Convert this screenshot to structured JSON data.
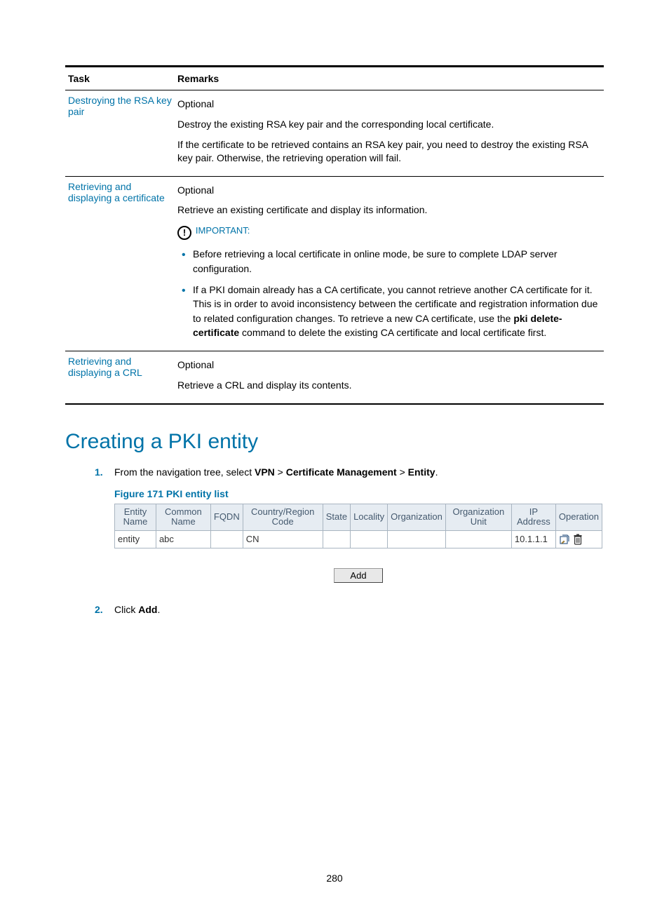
{
  "table": {
    "headers": {
      "task": "Task",
      "remarks": "Remarks"
    },
    "row1": {
      "task": "Destroying the RSA key pair",
      "p1": "Optional",
      "p2": "Destroy the existing RSA key pair and the corresponding local certificate.",
      "p3": "If the certificate to be retrieved contains an RSA key pair, you need to destroy the existing RSA key pair. Otherwise, the retrieving operation will fail."
    },
    "row2": {
      "task": "Retrieving and displaying a certificate",
      "p1": "Optional",
      "p2": "Retrieve an existing certificate and display its information.",
      "important": "IMPORTANT:",
      "b1": "Before retrieving a local certificate in online mode, be sure to complete LDAP server configuration.",
      "b2a": "If a PKI domain already has a CA certificate, you cannot retrieve another CA certificate for it. This is in order to avoid inconsistency between the certificate and registration information due to related configuration changes. To retrieve a new CA certificate, use the ",
      "b2cmd": "pki delete-certificate",
      "b2b": " command to delete the existing CA certificate and local certificate first."
    },
    "row3": {
      "task": "Retrieving and displaying a CRL",
      "p1": "Optional",
      "p2": "Retrieve a CRL and display its contents."
    }
  },
  "heading": "Creating a PKI entity",
  "step1": {
    "pre": "From the navigation tree, select ",
    "b1": "VPN",
    "s1": " > ",
    "b2": "Certificate Management",
    "s2": " > ",
    "b3": "Entity",
    "post": "."
  },
  "figure_caption": "Figure 171 PKI entity list",
  "grid": {
    "headers": {
      "entity_name": "Entity Name",
      "common_name": "Common Name",
      "fqdn": "FQDN",
      "country": "Country/Region Code",
      "state": "State",
      "locality": "Locality",
      "org": "Organization",
      "org_unit": "Organization Unit",
      "ip": "IP Address",
      "operation": "Operation"
    },
    "row": {
      "entity_name": "entity",
      "common_name": "abc",
      "fqdn": "",
      "country": "CN",
      "state": "",
      "locality": "",
      "org": "",
      "org_unit": "",
      "ip": "10.1.1.1"
    }
  },
  "add_button": "Add",
  "step2": {
    "pre": "Click ",
    "b1": "Add",
    "post": "."
  },
  "page_number": "280"
}
